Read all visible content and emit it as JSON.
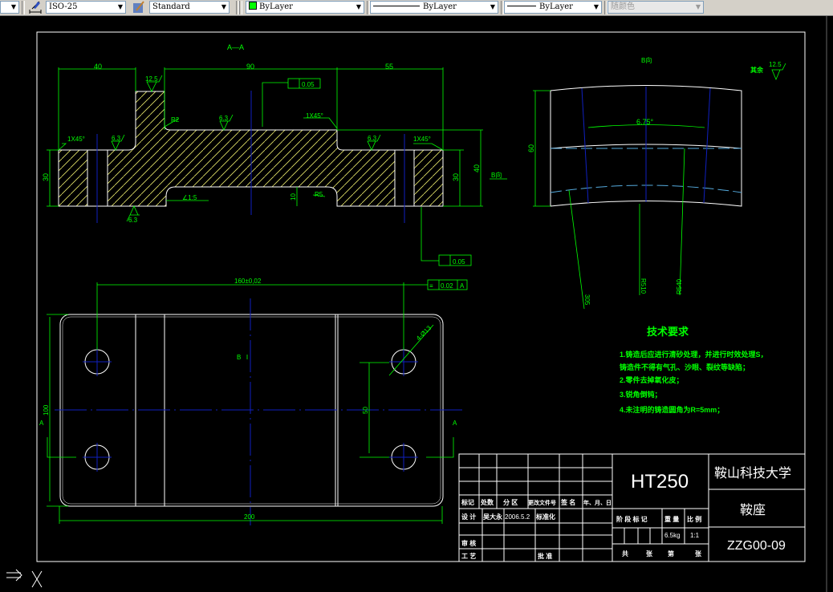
{
  "toolbar": {
    "dimstyle": "ISO-25",
    "textstyle": "Standard",
    "layer_color": "ByLayer",
    "linetype": "ByLayer",
    "lineweight": "ByLayer",
    "plotstyle": "随颜色",
    "layer_swatch_color": "#00ff00"
  },
  "drawing": {
    "section_label": "A—A",
    "section_view": {
      "dim_40": "40",
      "dim_90": "90",
      "dim_55": "55",
      "dim_30_left": "30",
      "dim_30_right": "30",
      "dim_40_right": "40",
      "dim_10": "10",
      "rough_12_5": "12.5",
      "rough_6_3_a": "6.3",
      "rough_6_3_b": "6.3",
      "rough_6_3_c": "6.3",
      "rough_6_3_bottom": "6.3",
      "chamfer_left": "1X45°",
      "chamfer_mid": "1X45°",
      "chamfer_right": "1X45°",
      "fillet_r2": "R2",
      "fillet_r5": "R5",
      "slope": "∠1:5",
      "flatness_top": "0.05",
      "flatness_bottom": "0.05",
      "view_b_arrow": "B向"
    },
    "b_view": {
      "title": "B向",
      "other_rough_label": "其余",
      "other_rough_value": "12.5",
      "angle": "6.75°",
      "dim_60": "60",
      "r305": "305",
      "r510": "R510",
      "r540": "R540"
    },
    "plan_view": {
      "dim_160": "160±0,02",
      "symmetry_value": "0.02",
      "symmetry_datum": "A",
      "hole_callout": "4-Ø13",
      "dim_200": "200",
      "dim_100": "100",
      "dim_50": "50",
      "cut_label_left": "A",
      "cut_label_right": "A",
      "datum_mark": "B"
    },
    "tech_req": {
      "title": "技术要求",
      "lines": [
        "1.铸造后应进行清砂处理，并进行时效处理S，",
        "铸造件不得有气孔、沙眼、裂纹等缺陷；",
        "2.零件去掉氧化皮；",
        "3.锐角倒钝；",
        "4.未注明的铸造圆角为R=5mm；"
      ]
    },
    "title_block": {
      "material": "HT250",
      "school": "鞍山科技大学",
      "part_name": "鞍座",
      "drawing_no": "ZZG00-09",
      "headers": [
        "标记",
        "处数",
        "分 区",
        "更改文件号",
        "签 名",
        "年、月、日"
      ],
      "design_label": "设 计",
      "designer": "吴大永",
      "date": "2006.5.2",
      "standardization": "标准化",
      "review_label": "审 核",
      "process_label": "工 艺",
      "approve_label": "批 准",
      "stage_mark": "阶 段 标 记",
      "weight_label": "重 量",
      "scale_label": "比 例",
      "weight": "6.5kg",
      "scale": "1:1",
      "sheets": [
        "共",
        "张",
        "第",
        "张"
      ]
    }
  }
}
